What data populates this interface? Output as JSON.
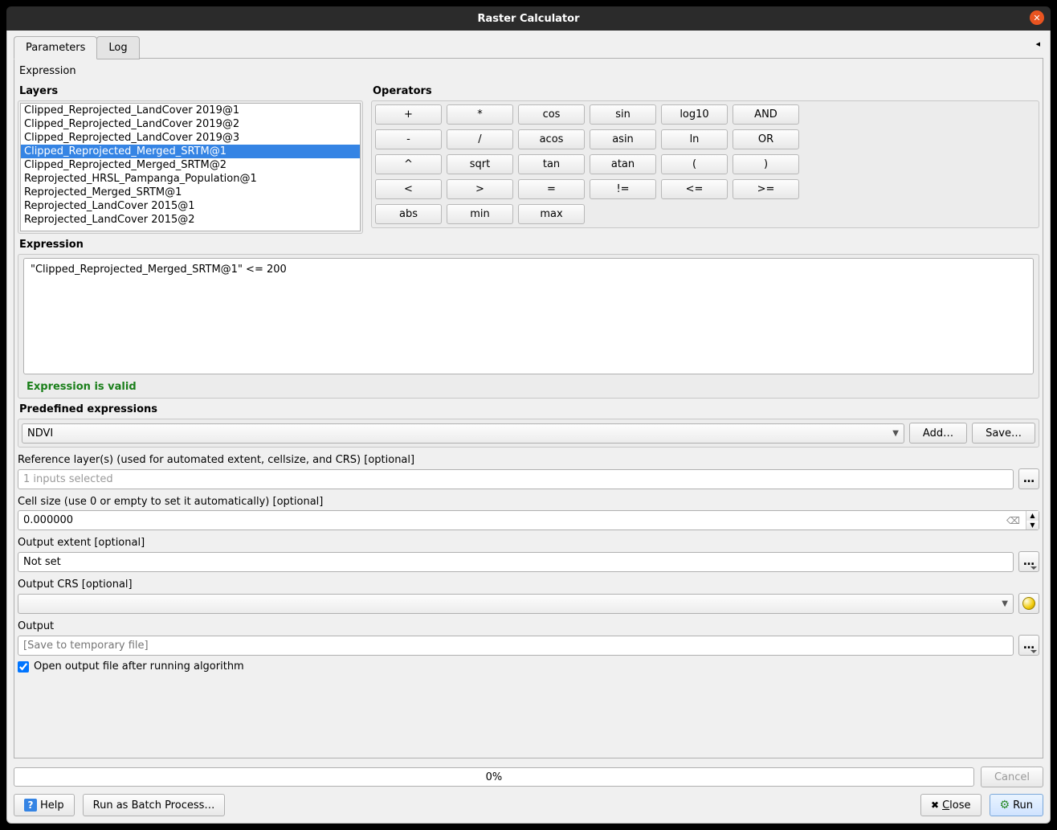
{
  "window": {
    "title": "Raster Calculator"
  },
  "tabs": {
    "parameters": "Parameters",
    "log": "Log"
  },
  "expression_label_top": "Expression",
  "layers_label": "Layers",
  "layers": [
    "Clipped_Reprojected_LandCover 2019@1",
    "Clipped_Reprojected_LandCover 2019@2",
    "Clipped_Reprojected_LandCover 2019@3",
    "Clipped_Reprojected_Merged_SRTM@1",
    "Clipped_Reprojected_Merged_SRTM@2",
    "Reprojected_HRSL_Pampanga_Population@1",
    "Reprojected_Merged_SRTM@1",
    "Reprojected_LandCover 2015@1",
    "Reprojected_LandCover 2015@2"
  ],
  "selected_layer_index": 3,
  "operators_label": "Operators",
  "operators": [
    [
      "+",
      "*",
      "cos",
      "sin",
      "log10",
      "AND"
    ],
    [
      "-",
      "/",
      "acos",
      "asin",
      "ln",
      "OR"
    ],
    [
      "^",
      "sqrt",
      "tan",
      "atan",
      "(",
      ")"
    ],
    [
      "<",
      ">",
      "=",
      "!=",
      "<=",
      ">="
    ],
    [
      "abs",
      "min",
      "max"
    ]
  ],
  "expression_label": "Expression",
  "expression_value": "\"Clipped_Reprojected_Merged_SRTM@1\" <= 200",
  "validation_message": "Expression is valid",
  "predefined_label": "Predefined expressions",
  "predefined_selected": "NDVI",
  "add_btn": "Add…",
  "save_btn": "Save…",
  "reference_label": "Reference layer(s) (used for automated extent, cellsize, and CRS) [optional]",
  "reference_value": "1 inputs selected",
  "cellsize_label": "Cell size (use 0 or empty to set it automatically) [optional]",
  "cellsize_value": "0.000000",
  "extent_label": "Output extent [optional]",
  "extent_value": "Not set",
  "crs_label": "Output CRS [optional]",
  "crs_value": "",
  "output_label": "Output",
  "output_placeholder": "[Save to temporary file]",
  "open_after_label": "Open output file after running algorithm",
  "open_after_checked": true,
  "progress_text": "0%",
  "cancel_btn": "Cancel",
  "help_btn": "Help",
  "batch_btn": "Run as Batch Process…",
  "close_btn": "Close",
  "run_btn": "Run"
}
